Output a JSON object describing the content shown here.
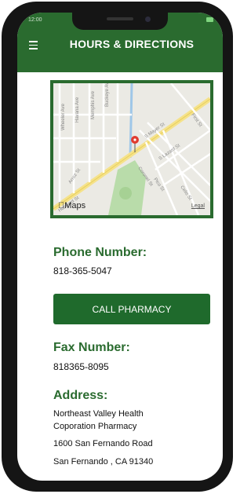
{
  "status": {
    "left": "12:00"
  },
  "header": {
    "title": "HOURS & DIRECTIONS",
    "menu_icon": "hamburger-menu-icon"
  },
  "map": {
    "maps_label": "Maps",
    "legal_label": "Legal",
    "streets": [
      "Havana Ave",
      "Memphis Ave",
      "Buckeye Ave",
      "Wheeler Ave",
      "Arroz St",
      "Hubbard St",
      "S Mayer St",
      "Coronel St",
      "Pico St",
      "S Lazard St",
      "First St",
      "Celis St"
    ],
    "pin_color": "#e03b2f"
  },
  "phone": {
    "label": "Phone Number:",
    "value": "818-365-5047"
  },
  "call_button": {
    "label": "CALL PHARMACY"
  },
  "fax": {
    "label": "Fax Number:",
    "value": "818365-8095"
  },
  "address": {
    "label": "Address:",
    "lines": [
      "Northeast Valley Health",
      "Coporation Pharmacy",
      "1600 San Fernando Road",
      "San Fernando  , CA 91340"
    ]
  },
  "colors": {
    "brand_green": "#2a6b2f",
    "button_green": "#1f6a2c"
  }
}
